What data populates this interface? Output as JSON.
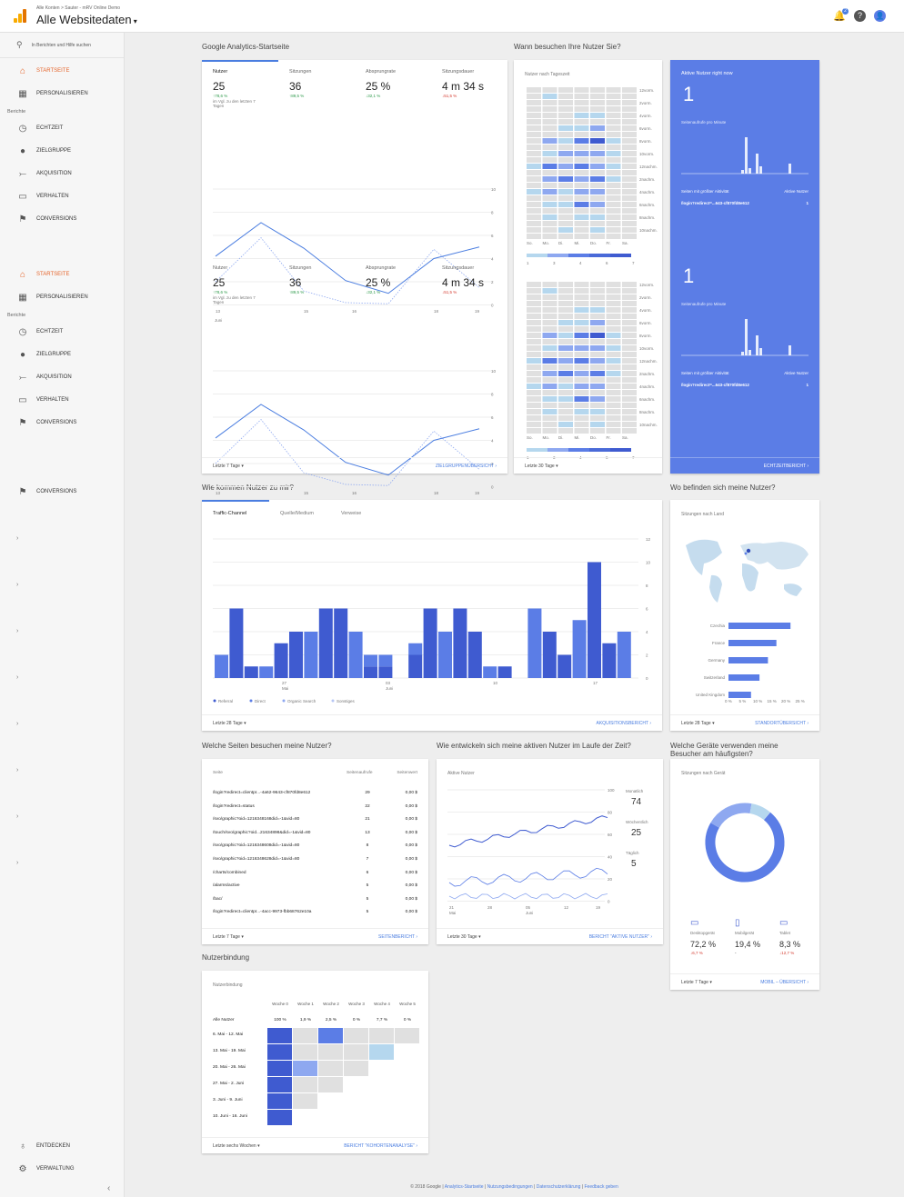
{
  "topbar": {
    "breadcrumb": "Alle Konten > Sauter - mRV Online Demo",
    "title": "Alle Websitedaten",
    "notif_count": "2"
  },
  "sidebar": {
    "search_placeholder": "In Berichten und Hilfe suchen",
    "group1": [
      {
        "icon": "home",
        "label": "STARTSEITE"
      },
      {
        "icon": "dashboard",
        "label": "PERSONALISIEREN"
      }
    ],
    "reports_label": "Berichte",
    "reports1": [
      {
        "icon": "clock",
        "label": "ECHTZEIT"
      },
      {
        "icon": "person",
        "label": "ZIELGRUPPE"
      },
      {
        "icon": "acquisition",
        "label": "AKQUISITION"
      },
      {
        "icon": "behavior",
        "label": "VERHALTEN"
      },
      {
        "icon": "flag",
        "label": "CONVERSIONS"
      }
    ],
    "group2": [
      {
        "icon": "home",
        "label": "STARTSEITE"
      },
      {
        "icon": "dashboard",
        "label": "PERSONALISIEREN"
      }
    ],
    "reports2": [
      {
        "icon": "clock",
        "label": "ECHTZEIT"
      },
      {
        "icon": "person",
        "label": "ZIELGRUPPE"
      },
      {
        "icon": "acquisition",
        "label": "AKQUISITION"
      },
      {
        "icon": "behavior",
        "label": "VERHALTEN"
      },
      {
        "icon": "flag",
        "label": "CONVERSIONS"
      }
    ],
    "conversions3": "CONVERSIONS",
    "bottom": [
      {
        "icon": "bulb",
        "label": "ENTDECKEN"
      },
      {
        "icon": "gear",
        "label": "VERWALTUNG"
      }
    ]
  },
  "sections": {
    "home": "Google Analytics-Startseite",
    "when": "Wann besuchen Ihre Nutzer Sie?",
    "how": "Wie kommen Nutzer zu mir?",
    "where": "Wo befinden sich meine Nutzer?",
    "pages": "Welche Seiten besuchen meine Nutzer?",
    "active": "Wie entwickeln sich meine aktiven Nutzer im Laufe der Zeit?",
    "devices": "Welche Geräte verwenden meine Besucher am häufigsten?",
    "retention": "Nutzerbindung"
  },
  "kpis": [
    {
      "label": "Nutzer",
      "value": "25",
      "change": "↑78,6 %",
      "dir": "up",
      "note": "im Vgl. zu den letzten 7 Tagen"
    },
    {
      "label": "Sitzungen",
      "value": "36",
      "change": "↑89,5 %",
      "dir": "up"
    },
    {
      "label": "Absprungrate",
      "value": "25 %",
      "change": "↓32,1 %",
      "dir": "up"
    },
    {
      "label": "Sitzungsdauer",
      "value": "4 m 34 s",
      "change": "↓51,5 %",
      "dir": "dn"
    }
  ],
  "home_chart": {
    "ylabels": [
      "10",
      "8",
      "6",
      "4",
      "2",
      "0"
    ],
    "xlabels": [
      "13",
      "15",
      "16",
      "18",
      "19"
    ],
    "xsub": "Juni",
    "footer_left": "Letzte 7 Tage ▾",
    "footer_link": "ZIELGRUPPENÜBERSICHT"
  },
  "heatmap": {
    "title": "Nutzer nach Tageszeit",
    "hours": [
      "12vorm.",
      "2vorm.",
      "4vorm.",
      "6vorm.",
      "8vorm.",
      "10vorm.",
      "12nachm.",
      "2nachm.",
      "4nachm.",
      "6nachm.",
      "8nachm.",
      "10nachm."
    ],
    "days": [
      "So.",
      "Mo.",
      "Di.",
      "Mi.",
      "Do.",
      "Fr.",
      "Sa."
    ],
    "legend": [
      "1",
      "3",
      "4",
      "6",
      "7"
    ],
    "footer_left": "Letzte 30 Tage ▾"
  },
  "live": {
    "title": "Aktive Nutzer right now",
    "count": "1",
    "per_min": "Seitenaufrufe pro Minute",
    "pages_label": "Seiten mit größter Aktivität",
    "users_label": "Aktive Nutzer",
    "page": "/login?redirect=...643-cf870fd8e612",
    "page_users": "1",
    "link": "ECHTZEITBERICHT"
  },
  "traffic": {
    "tabs": [
      "Traffic-Channel",
      "Quelle/Medium",
      "Verweise"
    ],
    "ylabels": [
      "12",
      "10",
      "8",
      "6",
      "4",
      "2",
      "0"
    ],
    "xlabels": [
      {
        "t": "27",
        "s": "Mai"
      },
      {
        "t": "03",
        "s": "Juni"
      },
      {
        "t": "10",
        "s": ""
      },
      {
        "t": "17",
        "s": ""
      }
    ],
    "legend": [
      {
        "name": "Referral",
        "color": "#3f5bd0"
      },
      {
        "name": "Direct",
        "color": "#5b7de6"
      },
      {
        "name": "Organic Search",
        "color": "#8ea8f0"
      },
      {
        "name": "Sonstiges",
        "color": "#b6c6f4"
      }
    ],
    "footer_left": "Letzte 28 Tage ▾",
    "footer_link": "AKQUISITIONSBERICHT"
  },
  "geo": {
    "title": "Sitzungen nach Land",
    "countries": [
      {
        "name": "Czechia",
        "value": 22
      },
      {
        "name": "France",
        "value": 17
      },
      {
        "name": "Germany",
        "value": 14
      },
      {
        "name": "Switzerland",
        "value": 11
      },
      {
        "name": "United Kingdom",
        "value": 8
      }
    ],
    "ticks": [
      "0 %",
      "5 %",
      "10 %",
      "15 %",
      "20 %",
      "25 %"
    ],
    "footer_left": "Letzte 28 Tage ▾",
    "footer_link": "STANDORTÜBERSICHT"
  },
  "pages": {
    "h_page": "Seite",
    "h_views": "Seitenaufrufe",
    "h_value": "Seitenwert",
    "rows": [
      {
        "p": "/login?redirect=clientpr...-4a62-9643-cf870fd8e612",
        "v": "29",
        "w": "0,00 $"
      },
      {
        "p": "/login?redirect=status",
        "v": "22",
        "w": "0,00 $"
      },
      {
        "p": "/svo/graphic?oid=1216348168did=-1&vid=80",
        "v": "21",
        "w": "0,00 $"
      },
      {
        "p": "/touch/svo/graphic?oid...21634898&did=-1&vid=80",
        "v": "13",
        "w": "0,00 $"
      },
      {
        "p": "/svo/graphic?oid=1216348608did=-1&vid=80",
        "v": "8",
        "w": "0,00 $"
      },
      {
        "p": "/svo/graphic?oid=1216348628did=-1&vid=80",
        "v": "7",
        "w": "0,00 $"
      },
      {
        "p": "/charts/combined",
        "v": "6",
        "w": "0,00 $"
      },
      {
        "p": "/alarms/active",
        "v": "5",
        "w": "0,00 $"
      },
      {
        "p": "/bac/",
        "v": "5",
        "w": "0,00 $"
      },
      {
        "p": "/login?redirect=clientpr...-4acc-9973-fbb68762e10a",
        "v": "5",
        "w": "0,00 $"
      }
    ],
    "footer_left": "Letzte 7 Tage ▾",
    "footer_link": "SEITENBERICHT"
  },
  "active": {
    "title": "Aktive Nutzer",
    "ylabels": [
      "100",
      "80",
      "60",
      "40",
      "20",
      "0"
    ],
    "xlabels": [
      {
        "t": "21",
        "s": "Mai"
      },
      {
        "t": "28",
        "s": ""
      },
      {
        "t": "05",
        "s": "Juni"
      },
      {
        "t": "12",
        "s": ""
      },
      {
        "t": "19",
        "s": ""
      }
    ],
    "series": [
      {
        "name": "Monatlich",
        "value": "74"
      },
      {
        "name": "Wöchentlich",
        "value": "25"
      },
      {
        "name": "Täglich",
        "value": "5"
      }
    ],
    "footer_left": "Letzte 30 Tage ▾",
    "footer_link": "BERICHT \"AKTIVE NUTZER\""
  },
  "devices": {
    "title": "Sitzungen nach Gerät",
    "items": [
      {
        "name": "Desktopgerät",
        "value": "72,2 %",
        "change": "↓6,7 %",
        "dir": "dn",
        "pct": 72.2
      },
      {
        "name": "Mobilgerät",
        "value": "19,4 %",
        "change": "-",
        "dir": "",
        "pct": 19.4
      },
      {
        "name": "Tablet",
        "value": "8,3 %",
        "change": "↓12,7 %",
        "dir": "dn",
        "pct": 8.3
      }
    ],
    "footer_left": "Letzte 7 Tage ▾",
    "footer_link": "MOBIL – ÜBERSICHT"
  },
  "retention": {
    "title": "Nutzerbindung",
    "weeks": [
      "Woche 0",
      "Woche 1",
      "Woche 2",
      "Woche 3",
      "Woche 4",
      "Woche 5"
    ],
    "all_label": "Alle Nutzer",
    "all_values": [
      "100 %",
      "1,9 %",
      "2,5 %",
      "0 %",
      "7,7 %",
      "0 %"
    ],
    "rows": [
      "6. Mai - 12. Mai",
      "13. Mai - 19. Mai",
      "20. Mai - 26. Mai",
      "27. Mai - 2. Juni",
      "3. Juni - 9. Juni",
      "10. Juni - 16. Juni"
    ],
    "footer_left": "Letzte sechs Wochen ▾",
    "footer_link": "BERICHT \"KOHORTENANALYSE\""
  },
  "footer": {
    "copyright": "© 2018 Google |",
    "links": [
      "Analytics-Startseite",
      "Nutzungsbedingungen",
      "Datenschutzerklärung",
      "Feedback geben"
    ]
  }
}
